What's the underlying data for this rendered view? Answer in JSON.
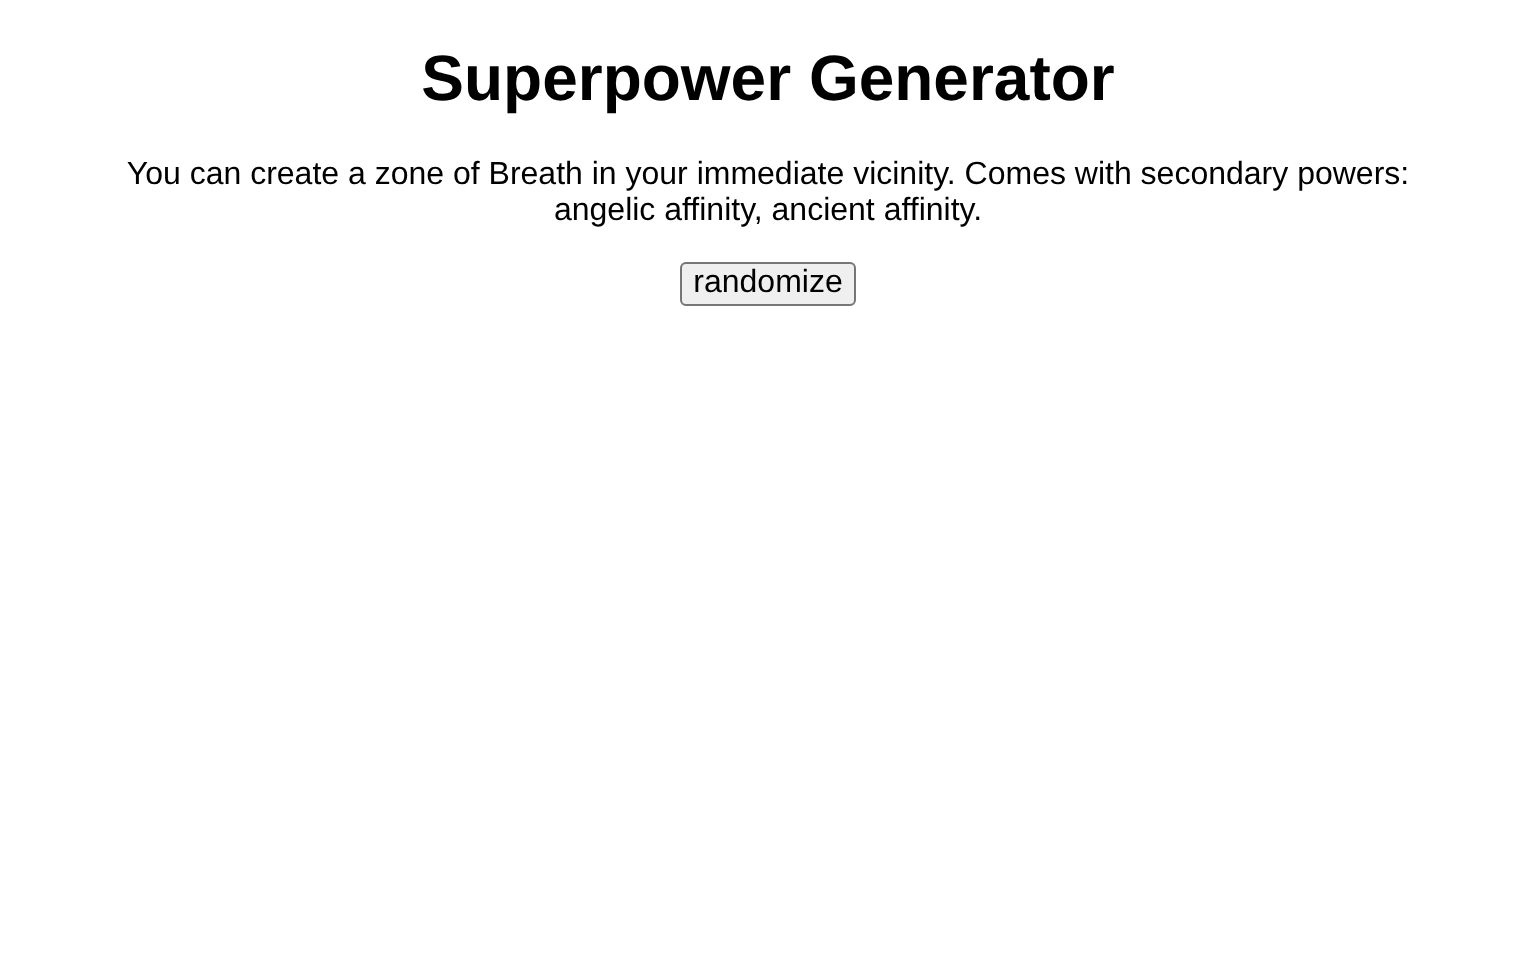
{
  "title": "Superpower Generator",
  "description": "You can create a zone of Breath in your immediate vicinity. Comes with secondary powers: angelic affinity, ancient affinity.",
  "button": {
    "label": "randomize"
  }
}
